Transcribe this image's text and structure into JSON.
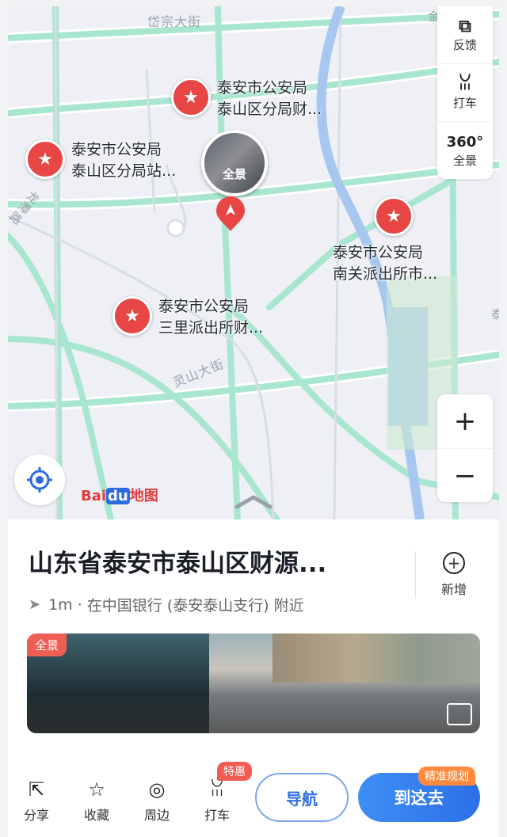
{
  "map": {
    "streets": [
      {
        "name": "岱宗大街"
      },
      {
        "name": "龙潭路"
      },
      {
        "name": "灵山大街"
      }
    ],
    "edge_fragments": {
      "top_right": "金",
      "right": "泰"
    },
    "pois": [
      {
        "line1": "泰安市公安局",
        "line2": "泰山区分局财..."
      },
      {
        "line1": "泰安市公安局",
        "line2": "泰山区分局站..."
      },
      {
        "line1": "泰安市公安局",
        "line2": "南关派出所市..."
      },
      {
        "line1": "泰安市公安局",
        "line2": "三里派出所财..."
      }
    ],
    "pano_bubble_label": "全景",
    "right_panel": [
      {
        "icon": "feedback-icon",
        "label": "反馈"
      },
      {
        "icon": "taxi-icon",
        "label": "打车"
      },
      {
        "icon": "panorama-360-icon",
        "label": "全景",
        "badge": "360°"
      }
    ],
    "zoom": {
      "in": "+",
      "out": "−"
    },
    "logo": {
      "bai": "Bai",
      "du": "du",
      "text": "地图"
    }
  },
  "sheet": {
    "title": "山东省泰安市泰山区财源...",
    "add_label": "新增",
    "distance": "1m",
    "separator": "·",
    "nearby": "在中国银行 (泰安泰山支行) 附近",
    "photo_tag": "全景"
  },
  "bottom": {
    "tools": [
      {
        "icon": "share-icon",
        "label": "分享"
      },
      {
        "icon": "star-icon",
        "label": "收藏"
      },
      {
        "icon": "compass-icon",
        "label": "周边"
      },
      {
        "icon": "taxi-icon",
        "label": "打车"
      }
    ],
    "tehui_badge": "特惠",
    "nav_label": "导航",
    "go_label": "到这去",
    "go_badge": "精准规划"
  },
  "colors": {
    "road": "#a8e6cf",
    "poi": "#e84545",
    "primary": "#2d6fe8",
    "badge": "#ff8a3d"
  }
}
